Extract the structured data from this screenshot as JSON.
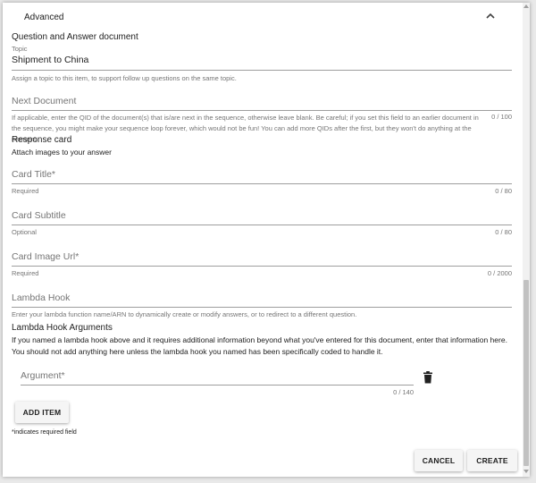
{
  "advanced": {
    "title": "Advanced"
  },
  "qa": {
    "section_title": "Question and Answer document"
  },
  "topic": {
    "label": "Topic",
    "value": "Shipment to China",
    "hint": "Assign a topic to this item, to support follow up questions on the same topic."
  },
  "next_document": {
    "placeholder": "Next Document",
    "hint": "If applicable, enter the QID of the document(s) that is/are next in the sequence, otherwise leave blank. Be careful; if you set this field to an earlier document in the sequence, you might make your sequence loop forever, which would not be fun! You can add more QIDs after the first, but they won't do anything at the moment.",
    "counter": "0 / 100"
  },
  "response_card": {
    "title": "Response card",
    "subtitle": "Attach images to your answer"
  },
  "card_title": {
    "placeholder": "Card Title*",
    "hint": "Required",
    "counter": "0 / 80"
  },
  "card_subtitle": {
    "placeholder": "Card Subtitle",
    "hint": "Optional",
    "counter": "0 / 80"
  },
  "card_image": {
    "placeholder": "Card Image Url*",
    "hint": "Required",
    "counter": "0 / 2000"
  },
  "lambda_hook": {
    "placeholder": "Lambda Hook",
    "hint": "Enter your lambda function name/ARN to dynamically create or modify answers, or to redirect to a different question."
  },
  "lambda_args": {
    "title": "Lambda Hook Arguments",
    "description": "If you named a lambda hook above and it requires additional information beyond what you've entered for this document, enter that information here. You should not add anything here unless the lambda hook you named has been specifically coded to handle it."
  },
  "argument": {
    "placeholder": "Argument*",
    "counter": "0 / 140"
  },
  "add_item": {
    "label": "ADD ITEM"
  },
  "required_note": "*indicates required field",
  "actions": {
    "cancel": "CANCEL",
    "create": "CREATE"
  },
  "icons": {
    "chevron": "chevron-up-icon",
    "delete": "trash-icon"
  },
  "colors": {
    "text": "#212121",
    "secondary": "#757575",
    "underline": "#9e9e9e",
    "button_bg": "#f5f5f5"
  }
}
